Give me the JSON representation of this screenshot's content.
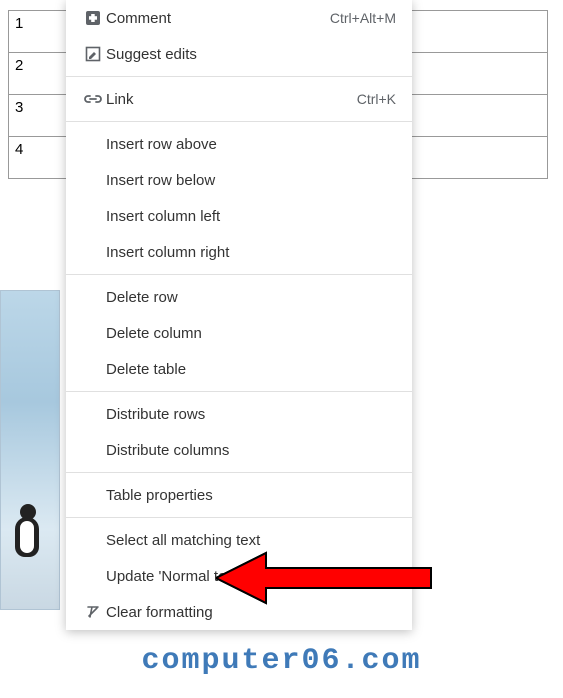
{
  "table": {
    "rows": [
      "1",
      "2",
      "3",
      "4"
    ]
  },
  "menu": {
    "comment": {
      "label": "Comment",
      "shortcut": "Ctrl+Alt+M"
    },
    "suggest": {
      "label": "Suggest edits"
    },
    "link": {
      "label": "Link",
      "shortcut": "Ctrl+K"
    },
    "insert_row_above": "Insert row above",
    "insert_row_below": "Insert row below",
    "insert_col_left": "Insert column left",
    "insert_col_right": "Insert column right",
    "delete_row": "Delete row",
    "delete_column": "Delete column",
    "delete_table": "Delete table",
    "distribute_rows": "Distribute rows",
    "distribute_cols": "Distribute columns",
    "table_properties": "Table properties",
    "select_matching": "Select all matching text",
    "update_normal": "Update 'Normal text' to match",
    "clear_formatting": "Clear formatting"
  },
  "watermark": "computer06.com"
}
